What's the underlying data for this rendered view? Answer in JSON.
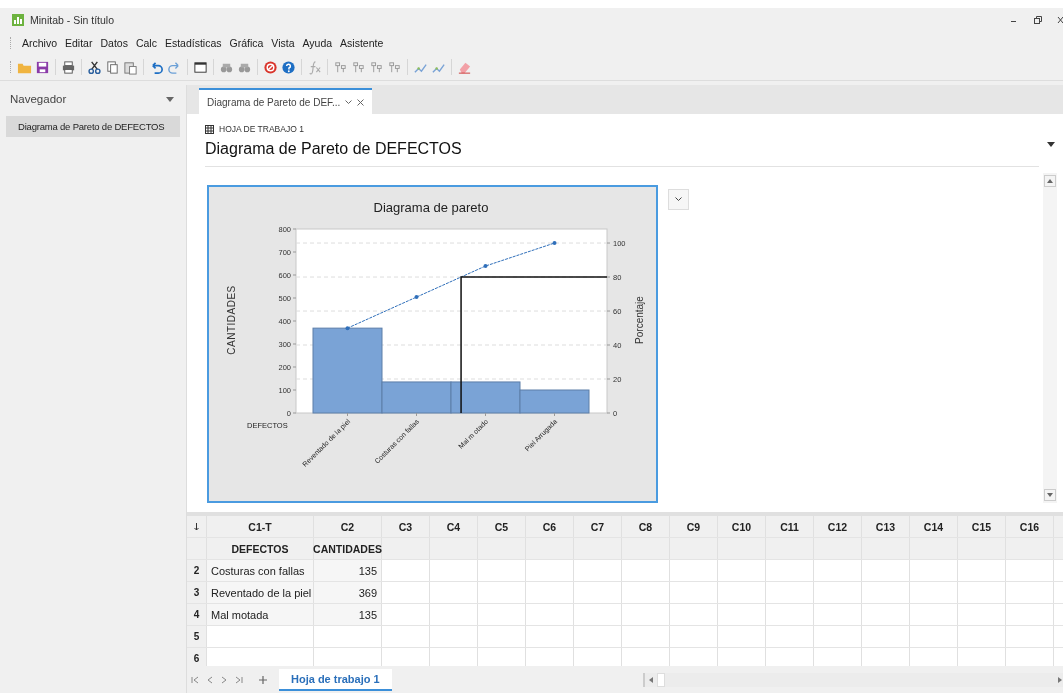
{
  "window": {
    "title": "Minitab - Sin título"
  },
  "menu": [
    {
      "label": "Archivo"
    },
    {
      "label": "Editar"
    },
    {
      "label": "Datos"
    },
    {
      "label": "Calc"
    },
    {
      "label": "Estadísticas"
    },
    {
      "label": "Gráfica"
    },
    {
      "label": "Vista"
    },
    {
      "label": "Ayuda"
    },
    {
      "label": "Asistente"
    }
  ],
  "navigator": {
    "title": "Navegador",
    "items": [
      {
        "label": "Diagrama de Pareto de DEFECTOS",
        "selected": true
      }
    ]
  },
  "tabs": [
    {
      "label": "Diagrama de Pareto de DEF...",
      "selected": true
    }
  ],
  "output": {
    "worksheet": "HOJA DE TRABAJO 1",
    "title": "Diagrama de Pareto de DEFECTOS",
    "percent_axis": {
      "label": "Porcentaje",
      "ticks": [
        {
          "label": "100",
          "threshold": false
        },
        {
          "label": "80",
          "threshold": true
        },
        {
          "label": "60",
          "threshold": false
        },
        {
          "label": "40",
          "threshold": false
        },
        {
          "label": "20",
          "threshold": false
        },
        {
          "label": "0",
          "threshold": false
        }
      ]
    },
    "chart_data": {
      "type": "bar",
      "title": "Diagrama de pareto",
      "xlabel": "DEFECTOS",
      "ylabel": "CANTIDADES",
      "categories": [
        "Reventado de la piel",
        "Costuras con fallas",
        "Mal m otado",
        "Piel Arrugada"
      ],
      "series": [
        {
          "color": "#7aa3d6",
          "values": [
            369,
            135,
            135,
            100
          ]
        },
        {
          "type": "line",
          "line_style": "dashed",
          "color": "#2f6fba",
          "values": [
            369,
            504,
            639,
            739
          ]
        }
      ],
      "ylim": [
        0,
        800
      ],
      "yticks": [
        0,
        100,
        200,
        300,
        400,
        500,
        600,
        700,
        800
      ]
    }
  },
  "worksheet": {
    "columns": [
      {
        "id": "C1-T",
        "name": "DEFECTOS",
        "kind": "text"
      },
      {
        "id": "C2",
        "name": "CANTIDADES",
        "kind": "numeric"
      },
      {
        "id": "C3"
      },
      {
        "id": "C4"
      },
      {
        "id": "C5"
      },
      {
        "id": "C6"
      },
      {
        "id": "C7"
      },
      {
        "id": "C8"
      },
      {
        "id": "C9"
      },
      {
        "id": "C10"
      },
      {
        "id": "C11"
      },
      {
        "id": "C12"
      },
      {
        "id": "C13"
      },
      {
        "id": "C14"
      },
      {
        "id": "C15"
      },
      {
        "id": "C16"
      }
    ],
    "rows": [
      {
        "number": "2",
        "cells": [
          "Costuras con fallas",
          "135"
        ]
      },
      {
        "number": "3",
        "cells": [
          "Reventado de la piel",
          "369"
        ]
      },
      {
        "number": "4",
        "cells": [
          "Mal motada",
          "135"
        ]
      },
      {
        "number": "5"
      },
      {
        "number": "6"
      }
    ]
  },
  "sheet_tabs": [
    {
      "label": "Hoja de trabajo 1",
      "selected": true
    }
  ]
}
